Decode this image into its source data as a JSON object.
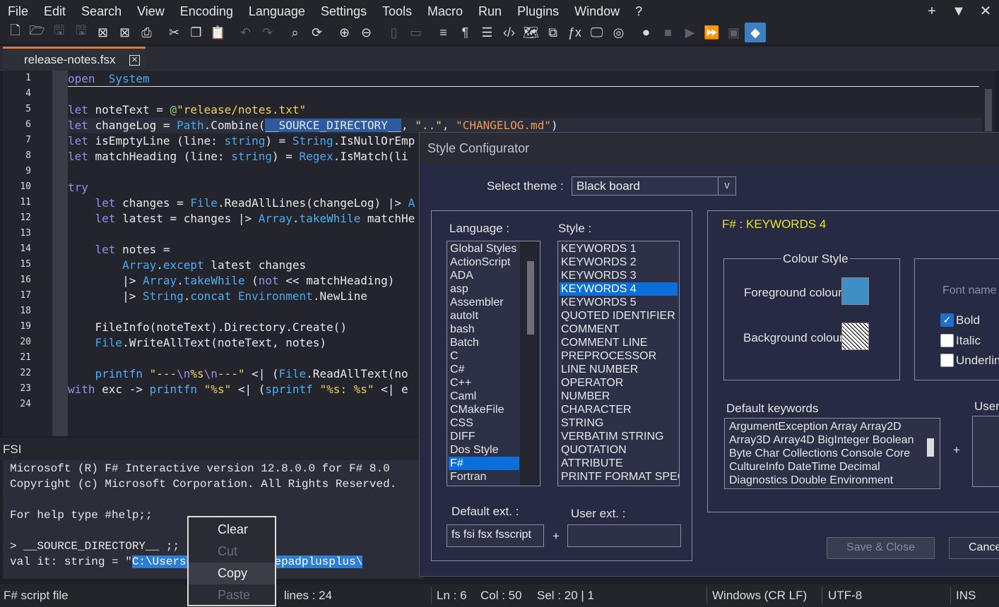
{
  "menubar": {
    "items": [
      "File",
      "Edit",
      "Search",
      "View",
      "Encoding",
      "Language",
      "Settings",
      "Tools",
      "Macro",
      "Run",
      "Plugins",
      "Window",
      "?"
    ],
    "right": [
      "+",
      "▼",
      "✕"
    ]
  },
  "tab": {
    "title": "release-notes.fsx",
    "close": "✕"
  },
  "editor": {
    "line_numbers": [
      "1",
      "4",
      "5",
      "6",
      "7",
      "8",
      "9",
      "10",
      "11",
      "12",
      "13",
      "14",
      "15",
      "16",
      "17",
      "18",
      "19",
      "20",
      "21",
      "22",
      "23",
      "24"
    ],
    "lines": [
      [
        [
          "kw",
          "open"
        ],
        [
          "",
          "  "
        ],
        [
          "ty",
          "System"
        ]
      ],
      [],
      [
        [
          "kw",
          "let"
        ],
        [
          "",
          " noteText = "
        ],
        [
          "gr",
          "@"
        ],
        [
          "st",
          "\"release/notes.txt\""
        ]
      ],
      [
        [
          "kw",
          "let"
        ],
        [
          "",
          " changeLog = "
        ],
        [
          "ty",
          "Path"
        ],
        [
          "",
          ".Combine("
        ],
        [
          "sel",
          "__SOURCE_DIRECTORY__"
        ],
        [
          "",
          ", "
        ],
        [
          "st",
          "\"..\""
        ],
        [
          "",
          ", "
        ],
        [
          "st2",
          "\"CHANGELOG.md\""
        ],
        [
          "",
          ")"
        ]
      ],
      [
        [
          "kw",
          "let"
        ],
        [
          "",
          " isEmptyLine (line: "
        ],
        [
          "ty",
          "string"
        ],
        [
          "",
          ") = "
        ],
        [
          "ty",
          "String"
        ],
        [
          "",
          ".IsNullOrEmp"
        ]
      ],
      [
        [
          "kw",
          "let"
        ],
        [
          "",
          " matchHeading (line: "
        ],
        [
          "ty",
          "string"
        ],
        [
          "",
          ") = "
        ],
        [
          "ty",
          "Regex"
        ],
        [
          "",
          ".IsMatch(li"
        ]
      ],
      [],
      [
        [
          "kw",
          "try"
        ]
      ],
      [
        [
          "",
          "    "
        ],
        [
          "kw",
          "let"
        ],
        [
          "",
          " changes = "
        ],
        [
          "ty",
          "File"
        ],
        [
          "",
          ".ReadAllLines(changeLog) |> "
        ],
        [
          "ty",
          "A"
        ]
      ],
      [
        [
          "",
          "    "
        ],
        [
          "kw",
          "let"
        ],
        [
          "",
          " latest = changes |> "
        ],
        [
          "ty",
          "Array"
        ],
        [
          "",
          "."
        ],
        [
          "fn",
          "takeWhile"
        ],
        [
          "",
          " matchHe"
        ]
      ],
      [],
      [
        [
          "",
          "    "
        ],
        [
          "kw",
          "let"
        ],
        [
          "",
          " notes ="
        ]
      ],
      [
        [
          "",
          "        "
        ],
        [
          "ty",
          "Array"
        ],
        [
          "",
          "."
        ],
        [
          "fn",
          "except"
        ],
        [
          "",
          " latest changes"
        ]
      ],
      [
        [
          "",
          "        |> "
        ],
        [
          "ty",
          "Array"
        ],
        [
          "",
          "."
        ],
        [
          "fn",
          "takeWhile"
        ],
        [
          "",
          " ("
        ],
        [
          "kw",
          "not"
        ],
        [
          "",
          " << matchHeading)"
        ]
      ],
      [
        [
          "",
          "        |> "
        ],
        [
          "ty",
          "String"
        ],
        [
          "",
          "."
        ],
        [
          "fn",
          "concat"
        ],
        [
          "",
          " "
        ],
        [
          "ty",
          "Environment"
        ],
        [
          "",
          ".NewLine"
        ]
      ],
      [],
      [
        [
          "",
          "    FileInfo(noteText).Directory.Create()"
        ]
      ],
      [
        [
          "",
          "    "
        ],
        [
          "ty",
          "File"
        ],
        [
          "",
          ".WriteAllText(noteText, notes)"
        ]
      ],
      [],
      [
        [
          "",
          "    "
        ],
        [
          "fn",
          "printfn"
        ],
        [
          "",
          " "
        ],
        [
          "st",
          "\"---"
        ],
        [
          "kw",
          "\\n"
        ],
        [
          "st",
          "%s"
        ],
        [
          "kw",
          "\\n"
        ],
        [
          "st",
          "---\""
        ],
        [
          "",
          " <| ("
        ],
        [
          "ty",
          "File"
        ],
        [
          "",
          ".ReadAllText(no"
        ]
      ],
      [
        [
          "kw",
          "with"
        ],
        [
          "",
          " exc -> "
        ],
        [
          "fn",
          "printfn"
        ],
        [
          "",
          " "
        ],
        [
          "st",
          "\"%s\""
        ],
        [
          "",
          " <| ("
        ],
        [
          "fn",
          "sprintf"
        ],
        [
          "",
          " "
        ],
        [
          "st",
          "\"%s: %s\""
        ],
        [
          "",
          " <| e"
        ]
      ],
      []
    ]
  },
  "fsi": {
    "title": "FSI",
    "lines": [
      "Microsoft (R) F# Interactive version 12.8.0.0 for F# 8.0",
      "Copyright (c) Microsoft Corporation. All Rights Reserved.",
      "",
      "For help type #help;;",
      "",
      "> __SOURCE_DIRECTORY__ ;;"
    ],
    "last_prefix": "val it: string = \"",
    "last_selected": "C:\\Users\\...\\apps\\notepadplusplus\\"
  },
  "context_menu": {
    "items": [
      {
        "label": "Clear",
        "enabled": true
      },
      {
        "label": "Cut",
        "enabled": false
      },
      {
        "label": "Copy",
        "enabled": true
      },
      {
        "label": "Paste",
        "enabled": false
      }
    ]
  },
  "status": {
    "file_type": "F# script file",
    "lines": "lines : 24",
    "ln": "Ln : 6",
    "col": "Col : 50",
    "sel": "Sel : 20 | 1",
    "eol": "Windows (CR LF)",
    "encoding": "UTF-8",
    "mode": "INS"
  },
  "dialog": {
    "title": "Style Configurator",
    "select_theme_label": "Select theme :",
    "theme_value": "Black board",
    "theme_arrow": "v",
    "language_label": "Language :",
    "style_label": "Style :",
    "languages": [
      "Global Styles",
      "ActionScript",
      "ADA",
      "asp",
      "Assembler",
      "autoIt",
      "bash",
      "Batch",
      "C",
      "C#",
      "C++",
      "Caml",
      "CMakeFile",
      "CSS",
      "DIFF",
      "Dos Style",
      "F#",
      "Fortran"
    ],
    "selected_language": "F#",
    "styles": [
      "KEYWORDS 1",
      "KEYWORDS 2",
      "KEYWORDS 3",
      "KEYWORDS 4",
      "KEYWORDS 5",
      "QUOTED IDENTIFIER",
      "COMMENT",
      "COMMENT LINE",
      "PREPROCESSOR",
      "LINE NUMBER",
      "OPERATOR",
      "NUMBER",
      "CHARACTER",
      "STRING",
      "VERBATIM STRING",
      "QUOTATION",
      "ATTRIBUTE",
      "PRINTF FORMAT SPEC"
    ],
    "selected_style": "KEYWORDS 4",
    "style_heading": "F# : KEYWORDS 4",
    "colour_style_label": "Colour Style",
    "foreground_label": "Foreground colour",
    "background_label": "Background colour",
    "foreground_color": "#3d8fc6",
    "font_name_label": "Font name",
    "bold_label": "Bold",
    "italic_label": "Italic",
    "underline_label": "Underline",
    "bold_checked": true,
    "default_keywords_label": "Default keywords",
    "user_label": "User-",
    "default_keywords": [
      "ArgumentException Array Array2D",
      "Array3D Array4D BigInteger Boolean",
      "Byte Char Collections Console Core",
      "CultureInfo DateTime Decimal",
      "Diagnostics Double Environment"
    ],
    "default_ext_label": "Default ext. :",
    "default_ext_value": "fs fsi fsx fsscript",
    "user_ext_label": "User ext. :",
    "plus": "+",
    "save_close": "Save & Close",
    "cancel": "Cancel"
  }
}
